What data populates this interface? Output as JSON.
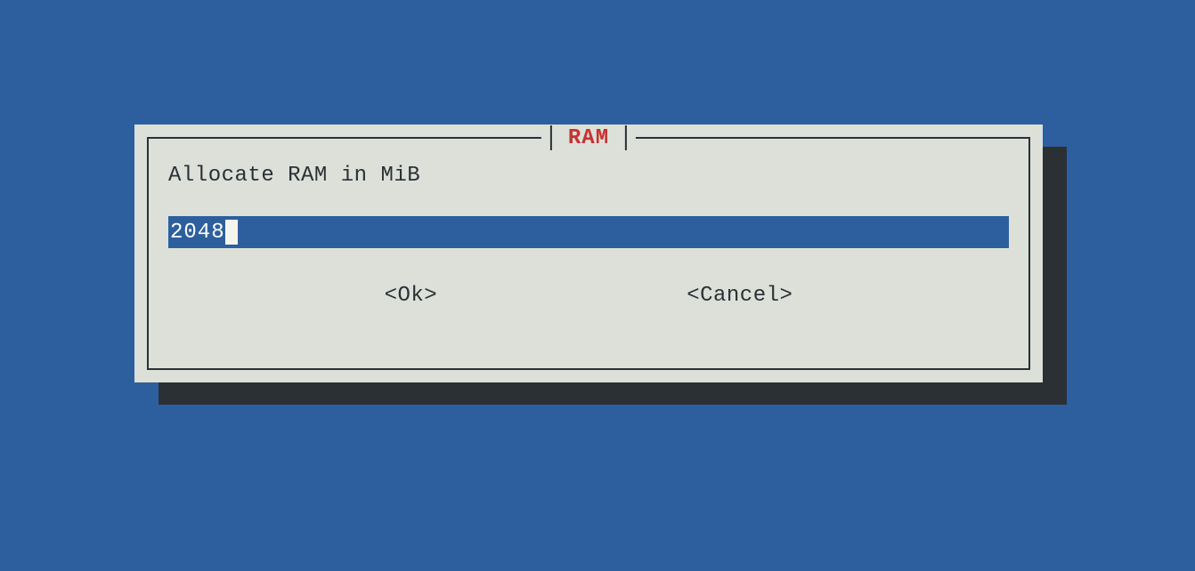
{
  "dialog": {
    "title": "RAM",
    "prompt": "Allocate RAM in MiB",
    "input_value": "2048",
    "ok_label": "<Ok>",
    "cancel_label": "<Cancel>"
  },
  "colors": {
    "background": "#2d5f9e",
    "dialog_bg": "#dce0d9",
    "shadow": "#2b3035",
    "title": "#c83232",
    "text": "#2b3035",
    "input_bg": "#2d5f9e",
    "input_fg": "#ffffff"
  }
}
